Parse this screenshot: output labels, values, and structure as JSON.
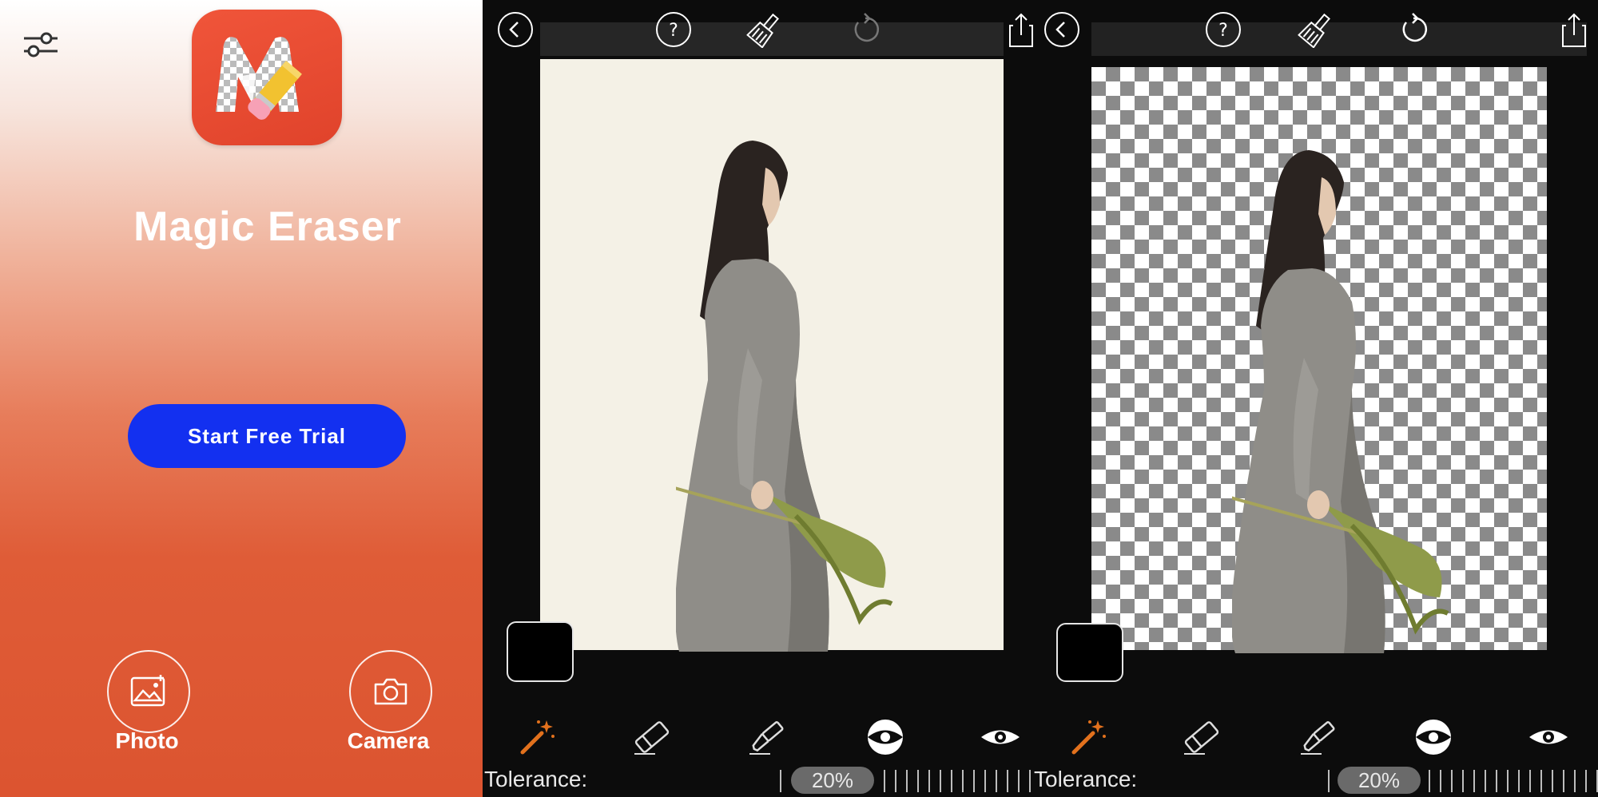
{
  "home": {
    "app_title": "Magic Eraser",
    "trial_button_label": "Start Free Trial",
    "photo_label": "Photo",
    "camera_label": "Camera",
    "icons": [
      "settings-sliders-icon",
      "app-logo-icon",
      "photo-icon",
      "camera-icon"
    ]
  },
  "editor_before": {
    "tolerance_label": "Tolerance:",
    "tolerance_value": "20%",
    "tools": [
      "magic-wand-icon",
      "eraser-icon",
      "brush-icon",
      "invert-icon",
      "preview-eye-icon"
    ],
    "top_icons": [
      "back-icon",
      "help-icon",
      "broom-icon",
      "undo-icon",
      "share-icon"
    ],
    "canvas_background": "plain"
  },
  "editor_after": {
    "tolerance_label": "Tolerance:",
    "tolerance_value": "20%",
    "tools": [
      "magic-wand-icon",
      "eraser-icon",
      "brush-icon",
      "invert-icon",
      "preview-eye-icon"
    ],
    "top_icons": [
      "back-icon",
      "help-icon",
      "broom-icon",
      "undo-icon",
      "share-icon"
    ],
    "canvas_background": "transparent-checkerboard"
  },
  "colors": {
    "accent_red": "#df5c37",
    "trial_blue": "#1330f0",
    "wand_orange": "#e2711d"
  }
}
